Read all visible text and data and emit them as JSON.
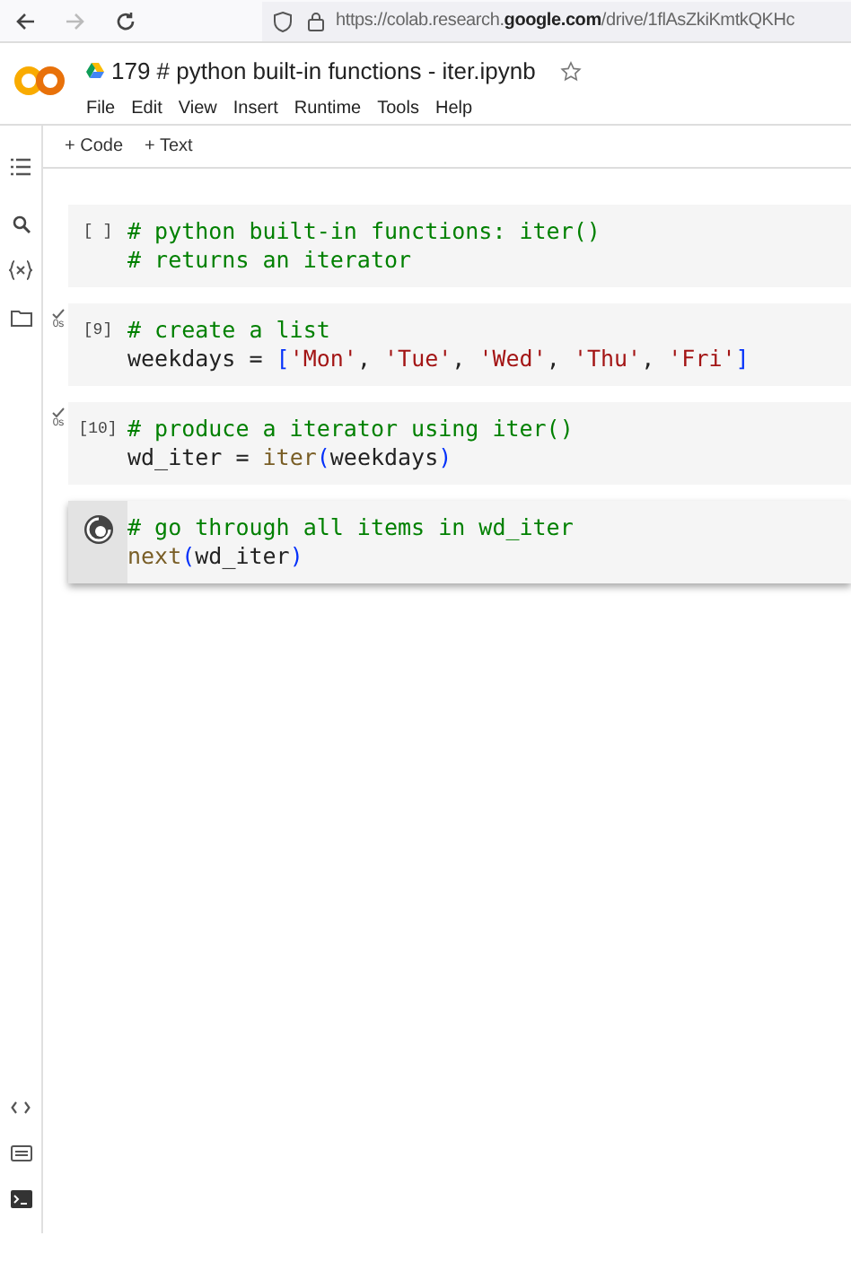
{
  "browser": {
    "url_prefix": "https://colab.research.",
    "url_domain": "google.com",
    "url_path": "/drive/1flAsZkiKmtkQKHc"
  },
  "notebook": {
    "title": "179 # python built-in functions - iter.ipynb",
    "starred": false
  },
  "menu": [
    "File",
    "Edit",
    "View",
    "Insert",
    "Runtime",
    "Tools",
    "Help"
  ],
  "toolbar": [
    "+ Code",
    "+ Text"
  ],
  "cells": [
    {
      "kind": "not_run",
      "execution_count": "[ ]",
      "focused": false,
      "lines": [
        [
          {
            "kind": "comment",
            "text": "# python built-in functions: iter()"
          }
        ],
        [
          {
            "kind": "comment",
            "text": "# returns an iterator"
          }
        ]
      ]
    },
    {
      "kind": "done",
      "execution_count": "[9]",
      "duration": "0s",
      "focused": false,
      "lines": [
        [
          {
            "kind": "comment",
            "text": "# create a list"
          }
        ],
        [
          {
            "kind": "plain",
            "text": "weekdays = "
          },
          {
            "kind": "paren",
            "text": "["
          },
          {
            "kind": "string",
            "text": "'Mon'"
          },
          {
            "kind": "plain",
            "text": ", "
          },
          {
            "kind": "string",
            "text": "'Tue'"
          },
          {
            "kind": "plain",
            "text": ", "
          },
          {
            "kind": "string",
            "text": "'Wed'"
          },
          {
            "kind": "plain",
            "text": ", "
          },
          {
            "kind": "string",
            "text": "'Thu'"
          },
          {
            "kind": "plain",
            "text": ", "
          },
          {
            "kind": "string",
            "text": "'Fri'"
          },
          {
            "kind": "paren",
            "text": "]"
          }
        ]
      ]
    },
    {
      "kind": "done",
      "execution_count": "[10]",
      "duration": "0s",
      "focused": false,
      "lines": [
        [
          {
            "kind": "comment",
            "text": "# produce a iterator using iter()"
          }
        ],
        [
          {
            "kind": "plain",
            "text": "wd_iter = "
          },
          {
            "kind": "builtin",
            "text": "iter"
          },
          {
            "kind": "paren",
            "text": "("
          },
          {
            "kind": "plain",
            "text": "weekdays"
          },
          {
            "kind": "paren",
            "text": ")"
          }
        ]
      ]
    },
    {
      "kind": "running",
      "focused": true,
      "lines": [
        [
          {
            "kind": "comment",
            "text": "# go through all items in wd_iter"
          }
        ],
        [
          {
            "kind": "builtin",
            "text": "next"
          },
          {
            "kind": "paren",
            "text": "("
          },
          {
            "kind": "plain",
            "text": "wd_iter"
          },
          {
            "kind": "paren",
            "text": ")"
          }
        ]
      ]
    }
  ]
}
